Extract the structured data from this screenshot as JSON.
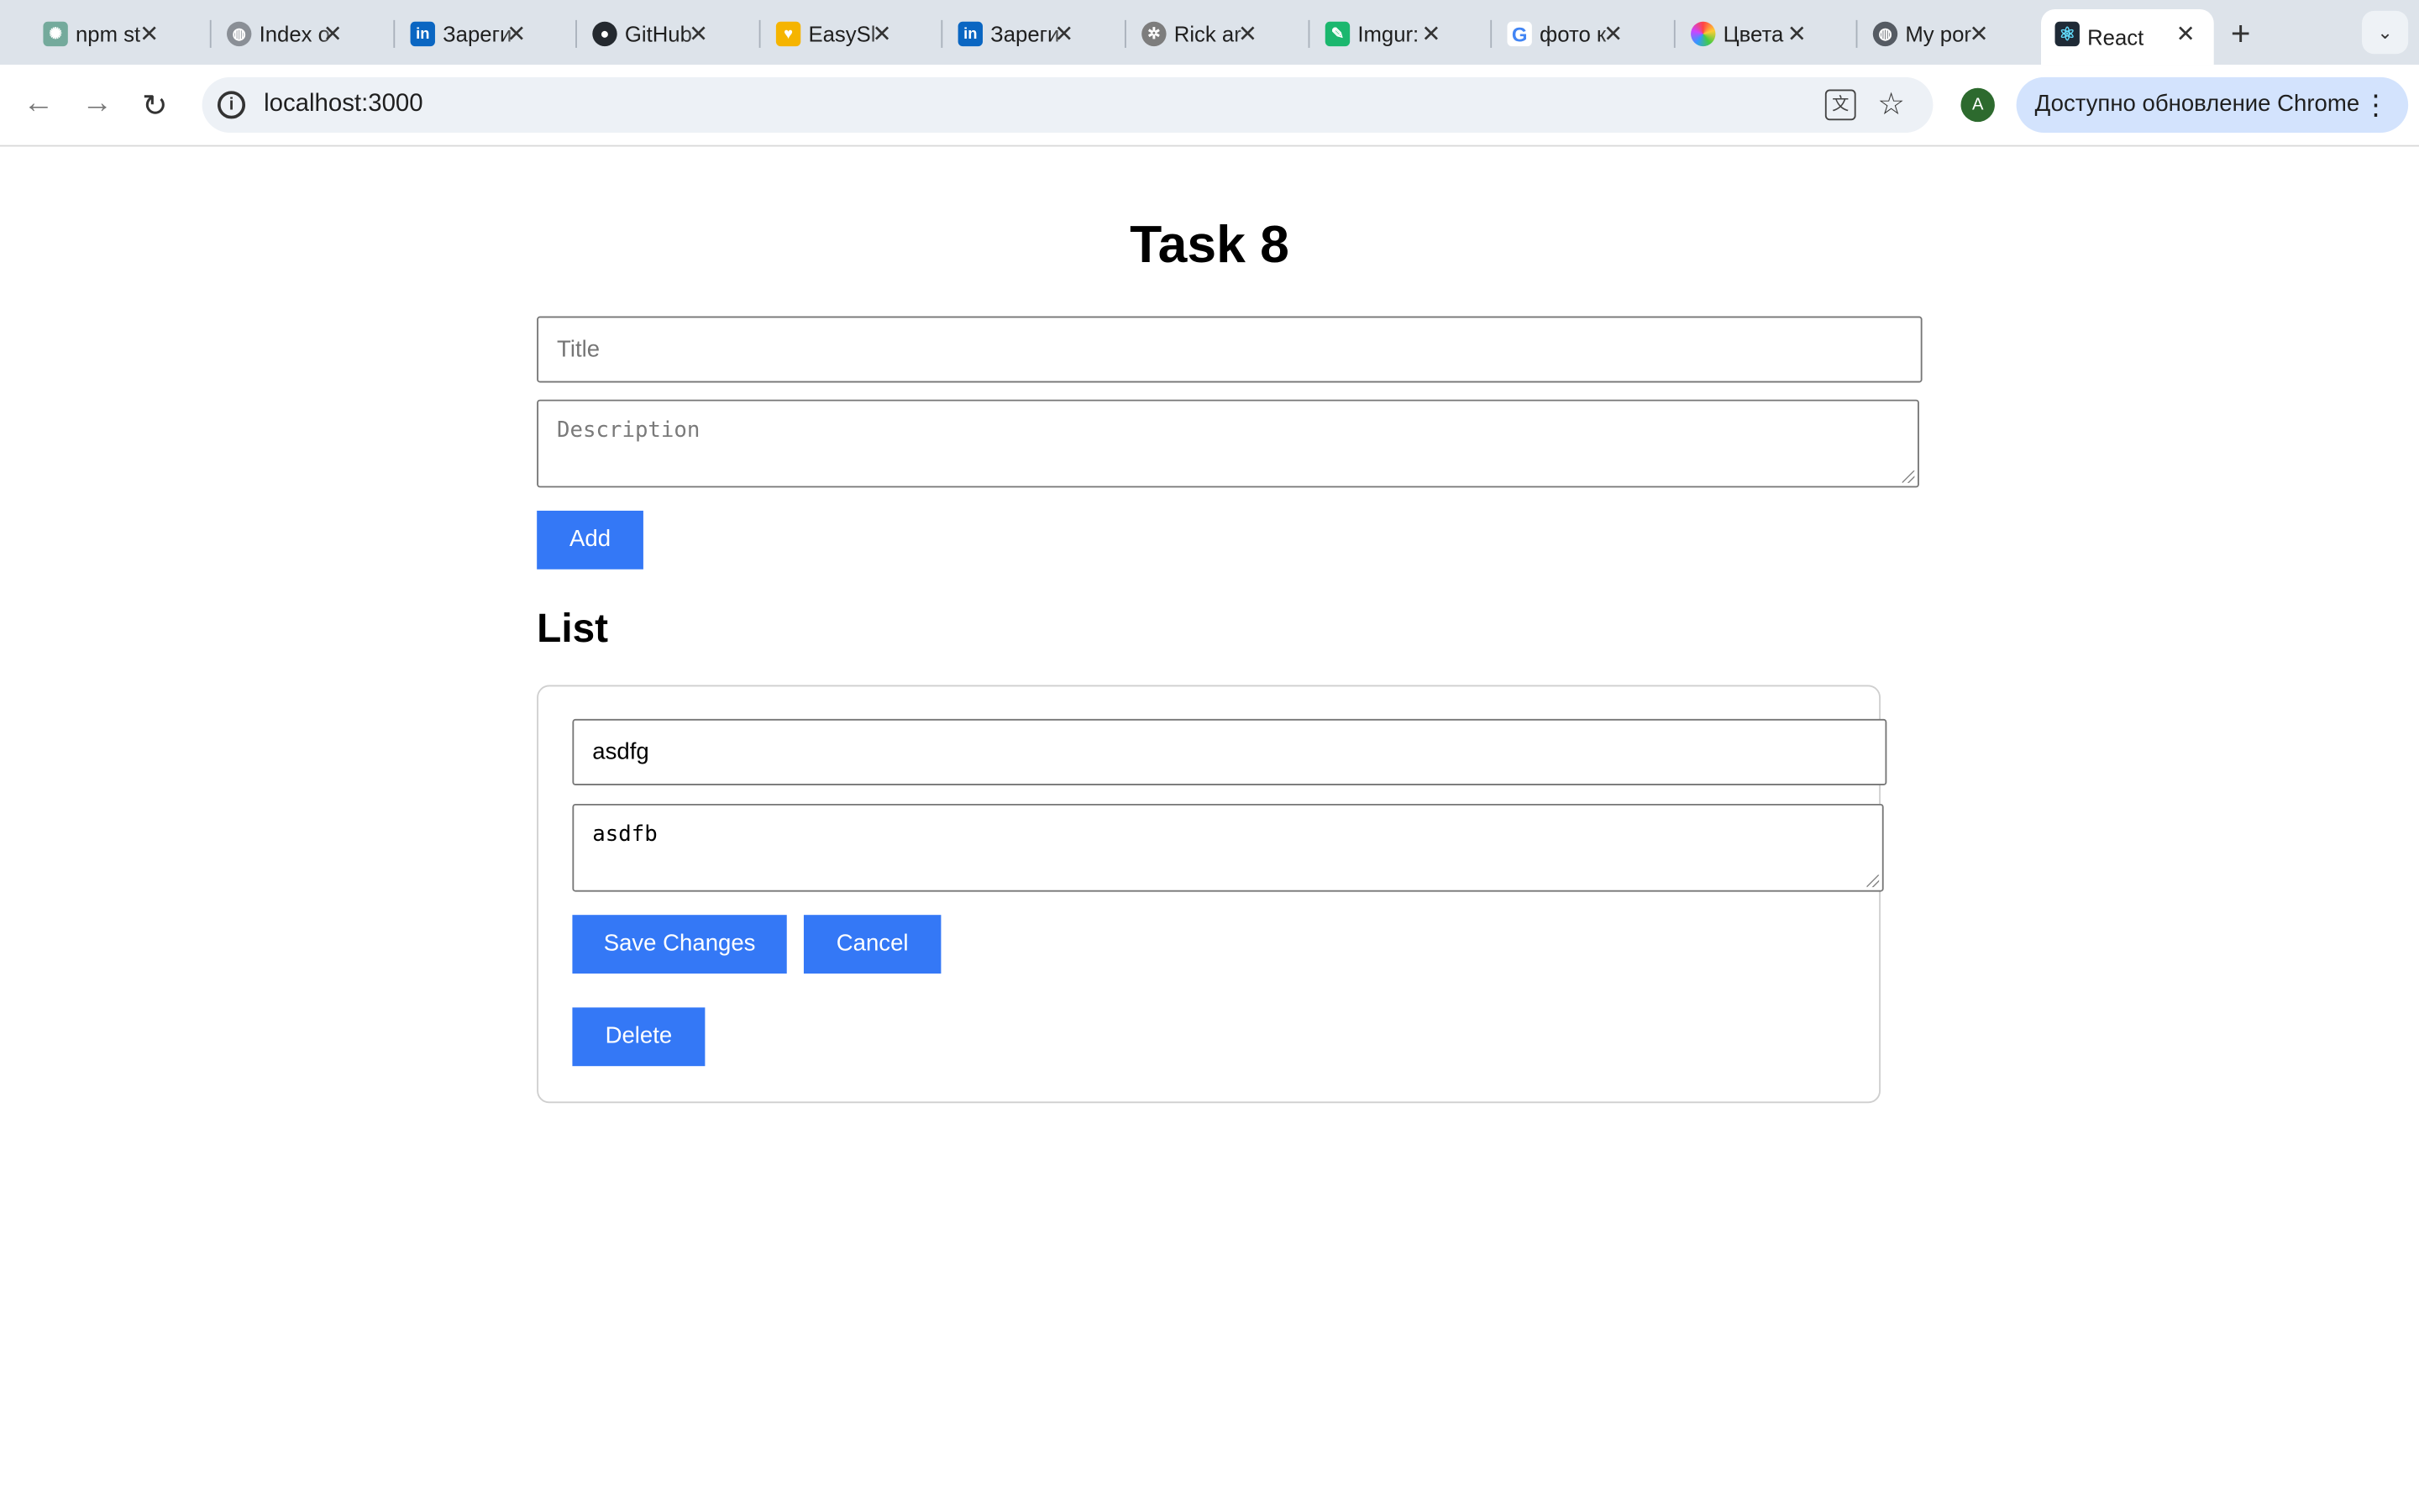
{
  "browser": {
    "tabs": [
      {
        "label": "npm st",
        "icon": "chatgpt-icon",
        "color": "#74aa9c"
      },
      {
        "label": "Index o",
        "icon": "globe-icon",
        "color": "#8a8f96"
      },
      {
        "label": "Зареги",
        "icon": "linkedin-icon",
        "color": "#0a66c2"
      },
      {
        "label": "GitHub",
        "icon": "github-icon",
        "color": "#24292f"
      },
      {
        "label": "EasySl",
        "icon": "easyslides-icon",
        "color": "#f5b400"
      },
      {
        "label": "Зареги",
        "icon": "linkedin-icon",
        "color": "#0a66c2"
      },
      {
        "label": "Rick ar",
        "icon": "rick-icon",
        "color": "#7d7d7d"
      },
      {
        "label": "Imgur:",
        "icon": "imgur-icon",
        "color": "#1bb76e"
      },
      {
        "label": "фото к",
        "icon": "google-icon",
        "color": "#4285f4"
      },
      {
        "label": "Цвета",
        "icon": "color-wheel-icon",
        "color": "#c94fd0"
      },
      {
        "label": "My por",
        "icon": "globe-icon",
        "color": "#555b63"
      },
      {
        "label": "React",
        "icon": "react-icon",
        "color": "#1f2a36",
        "active": true
      }
    ],
    "address": "localhost:3000",
    "avatar_letter": "A",
    "update_label": "Доступно обновление Chrome"
  },
  "form": {
    "heading": "Task 8",
    "title_placeholder": "Title",
    "description_placeholder": "Description",
    "add_label": "Add"
  },
  "list": {
    "heading": "List",
    "items": [
      {
        "title": "asdfg",
        "description": "asdfb",
        "save_label": "Save Changes",
        "cancel_label": "Cancel",
        "delete_label": "Delete"
      }
    ]
  },
  "colors": {
    "accent": "#3478f6",
    "tabstrip": "#dde3ea",
    "omnibox": "#edf1f6",
    "update_chip": "#d3e3fd"
  }
}
